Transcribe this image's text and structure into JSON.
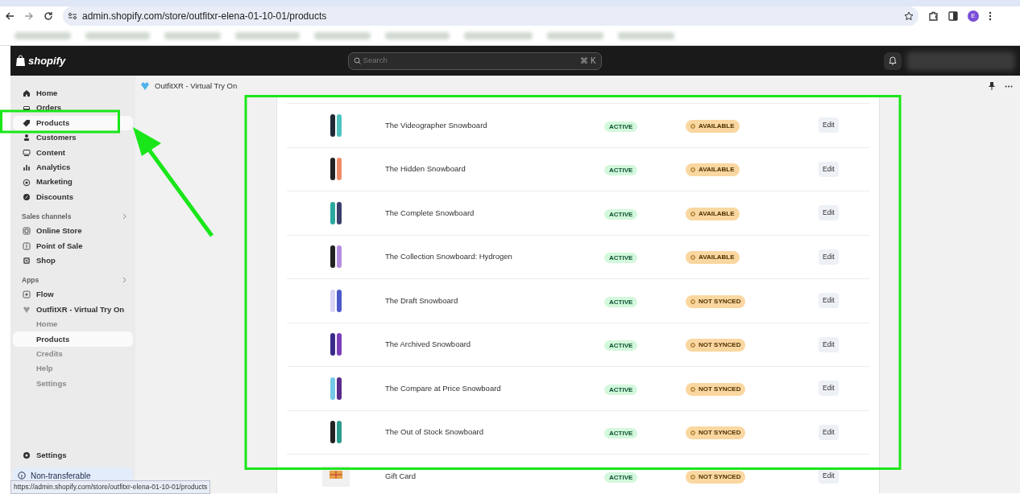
{
  "browser": {
    "url": "admin.shopify.com/store/outfitxr-elena-01-10-01/products",
    "profile_initial": "E"
  },
  "topbar": {
    "logo": "shopify",
    "search_placeholder": "Search",
    "shortcut": "⌘ K"
  },
  "sidebar": {
    "main": [
      {
        "label": "Home",
        "selected": false
      },
      {
        "label": "Orders",
        "selected": false
      },
      {
        "label": "Products",
        "selected": true
      },
      {
        "label": "Customers",
        "selected": false
      },
      {
        "label": "Content",
        "selected": false
      },
      {
        "label": "Analytics",
        "selected": false
      },
      {
        "label": "Marketing",
        "selected": false
      },
      {
        "label": "Discounts",
        "selected": false
      }
    ],
    "sales_channels": {
      "title": "Sales channels",
      "items": [
        {
          "label": "Online Store"
        },
        {
          "label": "Point of Sale"
        },
        {
          "label": "Shop"
        }
      ]
    },
    "apps": {
      "title": "Apps",
      "items": [
        {
          "label": "Flow"
        },
        {
          "label": "OutfitXR - Virtual Try On",
          "children": [
            {
              "label": "Home",
              "selected": false
            },
            {
              "label": "Products",
              "selected": true
            },
            {
              "label": "Credits",
              "selected": false
            },
            {
              "label": "Help",
              "selected": false
            },
            {
              "label": "Settings",
              "selected": false
            }
          ]
        }
      ]
    },
    "settings": "Settings",
    "notice": "Non-transferable"
  },
  "app_header": {
    "title": "OutfitXR - Virtual Try On"
  },
  "products": [
    {
      "kind": "snowboard",
      "name": "The Videographer Snowboard",
      "status": "ACTIVE",
      "sync": "AVAILABLE",
      "action": "Edit"
    },
    {
      "kind": "snowboard",
      "name": "The Hidden Snowboard",
      "status": "ACTIVE",
      "sync": "AVAILABLE",
      "action": "Edit"
    },
    {
      "kind": "snowboard",
      "name": "The Complete Snowboard",
      "status": "ACTIVE",
      "sync": "AVAILABLE",
      "action": "Edit"
    },
    {
      "kind": "snowboard",
      "name": "The Collection Snowboard: Hydrogen",
      "status": "ACTIVE",
      "sync": "AVAILABLE",
      "action": "Edit"
    },
    {
      "kind": "snowboard",
      "name": "The Draft Snowboard",
      "status": "ACTIVE",
      "sync": "NOT SYNCED",
      "action": "Edit"
    },
    {
      "kind": "snowboard",
      "name": "The Archived Snowboard",
      "status": "ACTIVE",
      "sync": "NOT SYNCED",
      "action": "Edit"
    },
    {
      "kind": "snowboard",
      "name": "The Compare at Price Snowboard",
      "status": "ACTIVE",
      "sync": "NOT SYNCED",
      "action": "Edit"
    },
    {
      "kind": "snowboard",
      "name": "The Out of Stock Snowboard",
      "status": "ACTIVE",
      "sync": "NOT SYNCED",
      "action": "Edit"
    },
    {
      "kind": "gift-card",
      "name": "Gift Card",
      "status": "ACTIVE",
      "sync": "NOT SYNCED",
      "action": "Edit"
    }
  ],
  "status_url": "https://admin.shopify.com/store/outfitxr-elena-01-10-01/products"
}
